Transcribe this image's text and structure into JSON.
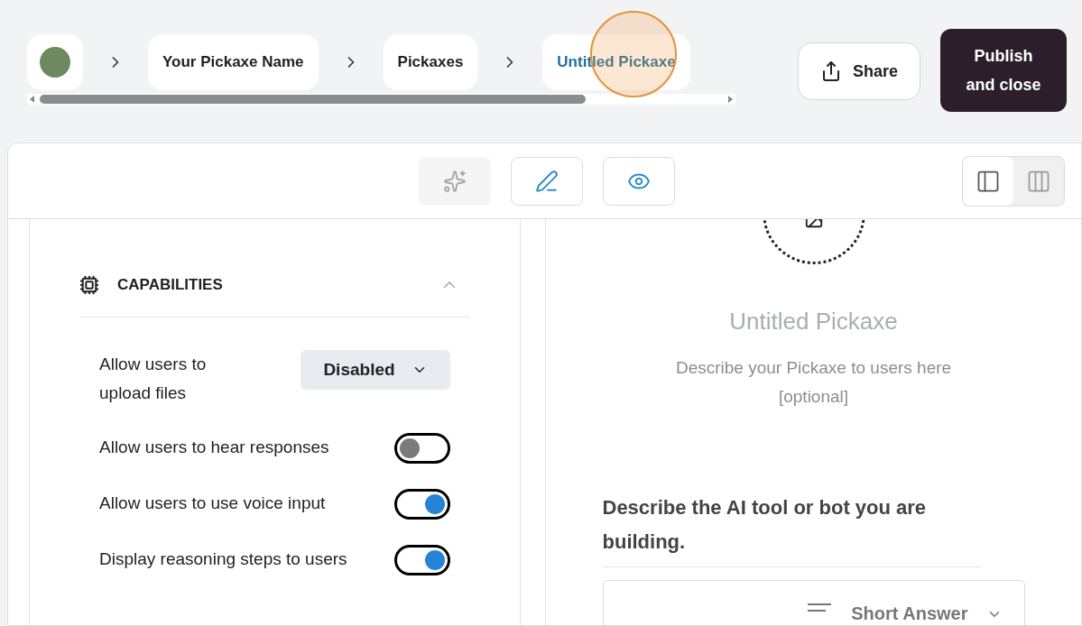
{
  "breadcrumbs": [
    {
      "label": "Your Pickaxe Name",
      "current": false
    },
    {
      "label": "Pickaxes",
      "current": false
    },
    {
      "label": "Untitled Pickaxe",
      "current": true
    }
  ],
  "header_buttons": {
    "share": "Share",
    "publish": "Publish and close"
  },
  "toolbar": {
    "tools": [
      {
        "kind": "sparkle",
        "disabled": true
      },
      {
        "kind": "edit",
        "disabled": false
      },
      {
        "kind": "preview",
        "disabled": false
      }
    ],
    "layouts": [
      {
        "kind": "single",
        "selected": true
      },
      {
        "kind": "columns",
        "selected": false
      }
    ]
  },
  "capabilities": {
    "title": "CAPABILITIES",
    "expanded": true,
    "settings": [
      {
        "kind": "select",
        "label": "Allow users to upload files",
        "value": "Disabled"
      },
      {
        "kind": "toggle",
        "label": "Allow users to hear responses",
        "on": false
      },
      {
        "kind": "toggle",
        "label": "Allow users to use voice input",
        "on": true
      },
      {
        "kind": "toggle",
        "label": "Display reasoning steps to users",
        "on": true
      }
    ]
  },
  "preview": {
    "title": "Untitled Pickaxe",
    "description": "Describe your Pickaxe to users here [optional]",
    "question": "Describe the AI tool or bot you are building.",
    "answer_type": "Short Answer"
  }
}
